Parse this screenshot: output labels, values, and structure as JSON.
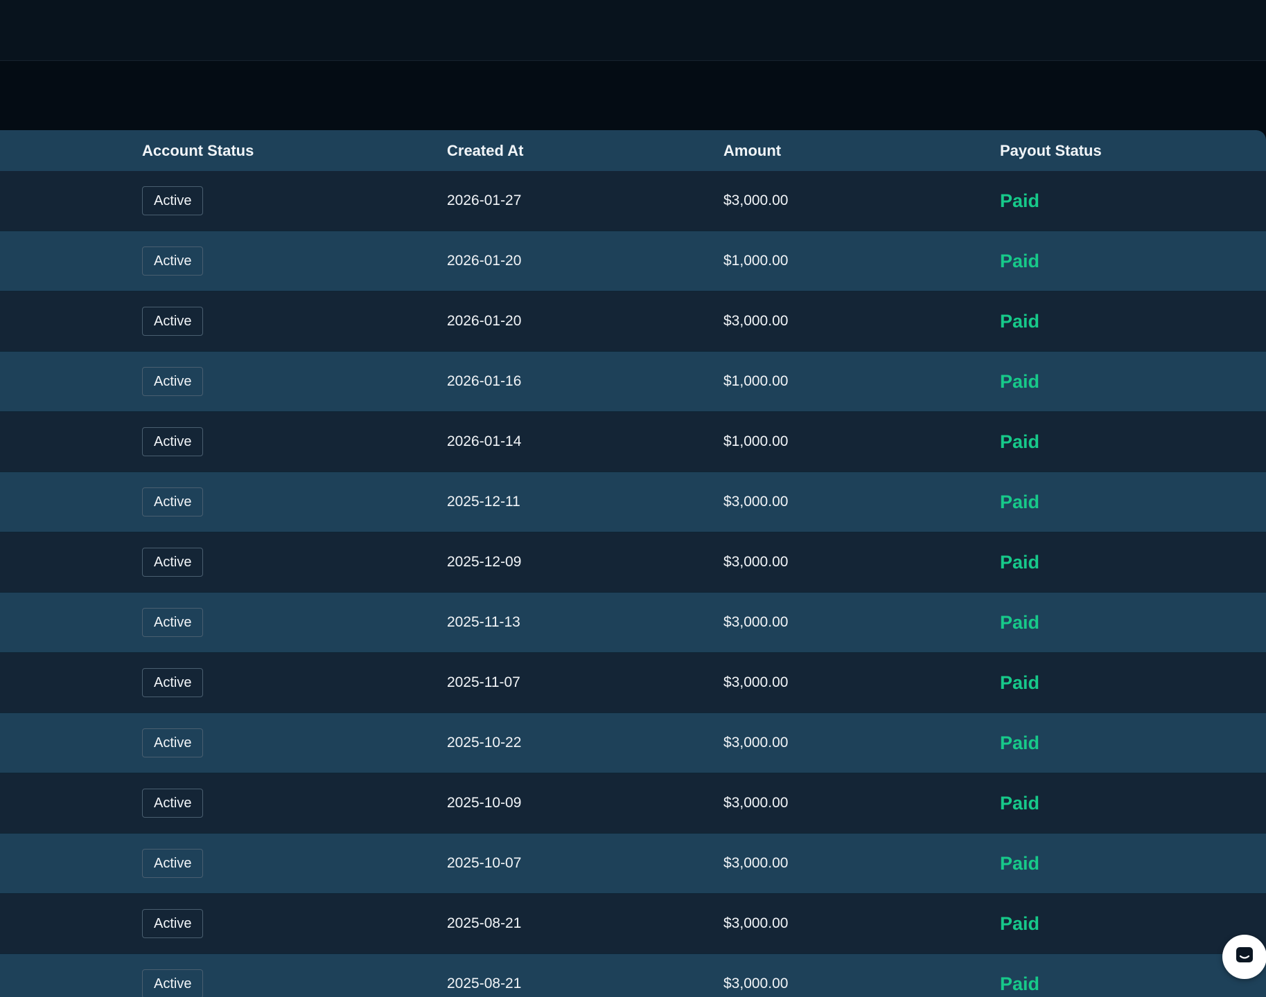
{
  "table": {
    "headers": {
      "account_status": "Account Status",
      "created_at": "Created At",
      "amount": "Amount",
      "payout_status": "Payout Status"
    },
    "rows": [
      {
        "account_status": "Active",
        "created_at": "2026-01-27",
        "amount": "$3,000.00",
        "payout_status": "Paid"
      },
      {
        "account_status": "Active",
        "created_at": "2026-01-20",
        "amount": "$1,000.00",
        "payout_status": "Paid"
      },
      {
        "account_status": "Active",
        "created_at": "2026-01-20",
        "amount": "$3,000.00",
        "payout_status": "Paid"
      },
      {
        "account_status": "Active",
        "created_at": "2026-01-16",
        "amount": "$1,000.00",
        "payout_status": "Paid"
      },
      {
        "account_status": "Active",
        "created_at": "2026-01-14",
        "amount": "$1,000.00",
        "payout_status": "Paid"
      },
      {
        "account_status": "Active",
        "created_at": "2025-12-11",
        "amount": "$3,000.00",
        "payout_status": "Paid"
      },
      {
        "account_status": "Active",
        "created_at": "2025-12-09",
        "amount": "$3,000.00",
        "payout_status": "Paid"
      },
      {
        "account_status": "Active",
        "created_at": "2025-11-13",
        "amount": "$3,000.00",
        "payout_status": "Paid"
      },
      {
        "account_status": "Active",
        "created_at": "2025-11-07",
        "amount": "$3,000.00",
        "payout_status": "Paid"
      },
      {
        "account_status": "Active",
        "created_at": "2025-10-22",
        "amount": "$3,000.00",
        "payout_status": "Paid"
      },
      {
        "account_status": "Active",
        "created_at": "2025-10-09",
        "amount": "$3,000.00",
        "payout_status": "Paid"
      },
      {
        "account_status": "Active",
        "created_at": "2025-10-07",
        "amount": "$3,000.00",
        "payout_status": "Paid"
      },
      {
        "account_status": "Active",
        "created_at": "2025-08-21",
        "amount": "$3,000.00",
        "payout_status": "Paid"
      },
      {
        "account_status": "Active",
        "created_at": "2025-08-21",
        "amount": "$3,000.00",
        "payout_status": "Paid"
      }
    ]
  },
  "chat_widget": {
    "icon": "chat-icon"
  },
  "colors": {
    "header_bg": "#1e4159",
    "row_dark": "#142536",
    "row_light": "#1e4159",
    "paid": "#17c98a",
    "page_bg": "#030b13"
  }
}
